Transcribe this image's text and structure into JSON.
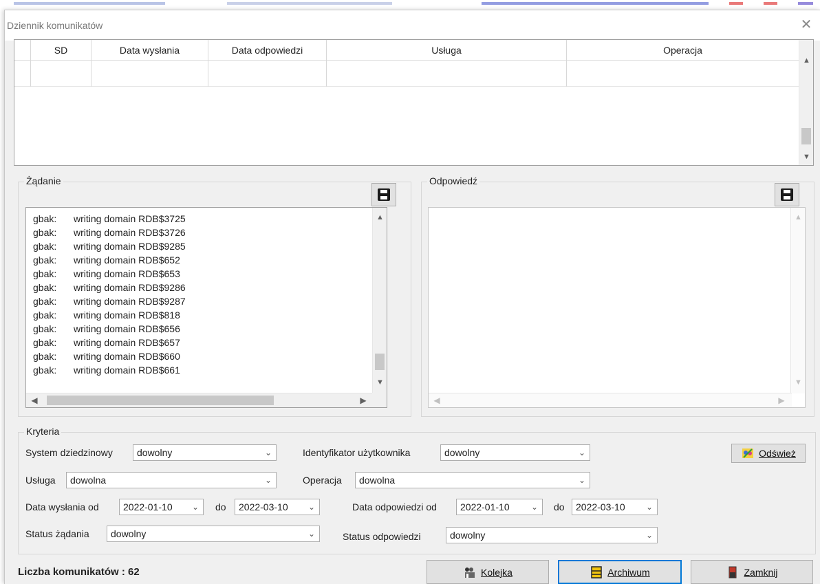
{
  "window": {
    "title": "Dziennik komunikatów",
    "close_glyph": "✕"
  },
  "grid": {
    "columns": [
      "",
      "SD",
      "Data wysłania",
      "Data odpowiedzi",
      "Usługa",
      "Operacja"
    ],
    "rows": [
      [
        "",
        "",
        "",
        "",
        "",
        ""
      ]
    ]
  },
  "request": {
    "label": "Żądanie",
    "lines": [
      {
        "prefix": "gbak:",
        "text": "writing domain RDB$3725"
      },
      {
        "prefix": "gbak:",
        "text": "writing domain RDB$3726"
      },
      {
        "prefix": "gbak:",
        "text": "writing domain RDB$9285"
      },
      {
        "prefix": "gbak:",
        "text": "writing domain RDB$652"
      },
      {
        "prefix": "gbak:",
        "text": "writing domain RDB$653"
      },
      {
        "prefix": "gbak:",
        "text": "writing domain RDB$9286"
      },
      {
        "prefix": "gbak:",
        "text": "writing domain RDB$9287"
      },
      {
        "prefix": "gbak:",
        "text": "writing domain RDB$818"
      },
      {
        "prefix": "gbak:",
        "text": "writing domain RDB$656"
      },
      {
        "prefix": "gbak:",
        "text": "writing domain RDB$657"
      },
      {
        "prefix": "gbak:",
        "text": "writing domain RDB$660"
      },
      {
        "prefix": "gbak:",
        "text": "writing domain RDB$661"
      }
    ]
  },
  "response": {
    "label": "Odpowiedź"
  },
  "criteria": {
    "label": "Kryteria",
    "domain_system_label": "System dziedzinowy",
    "domain_system_value": "dowolny",
    "user_id_label": "Identyfikator użytkownika",
    "user_id_value": "dowolny",
    "service_label": "Usługa",
    "service_value": "dowolna",
    "operation_label": "Operacja",
    "operation_value": "dowolna",
    "sent_from_label": "Data wysłania od",
    "sent_from_value": "2022-01-10",
    "sent_to_label": "do",
    "sent_to_value": "2022-03-10",
    "reply_from_label": "Data odpowiedzi od",
    "reply_from_value": "2022-01-10",
    "reply_to_label": "do",
    "reply_to_value": "2022-03-10",
    "request_status_label": "Status żądania",
    "request_status_value": "dowolny",
    "response_status_label": "Status odpowiedzi",
    "response_status_value": "dowolny",
    "refresh_label": "Odśwież"
  },
  "footer": {
    "count_text": "Liczba komunikatów : 62",
    "queue_label": "Kolejka",
    "archive_label": "Archiwum",
    "close_label": "Zamknij"
  },
  "icons": {
    "close": "close-icon",
    "save": "floppy-disk-icon",
    "refresh": "refresh-icon",
    "queue": "queue-icon",
    "archive": "archive-icon",
    "exit": "exit-door-icon"
  },
  "colors": {
    "accent_focus": "#0078d7",
    "background": "#f0f0f0"
  }
}
